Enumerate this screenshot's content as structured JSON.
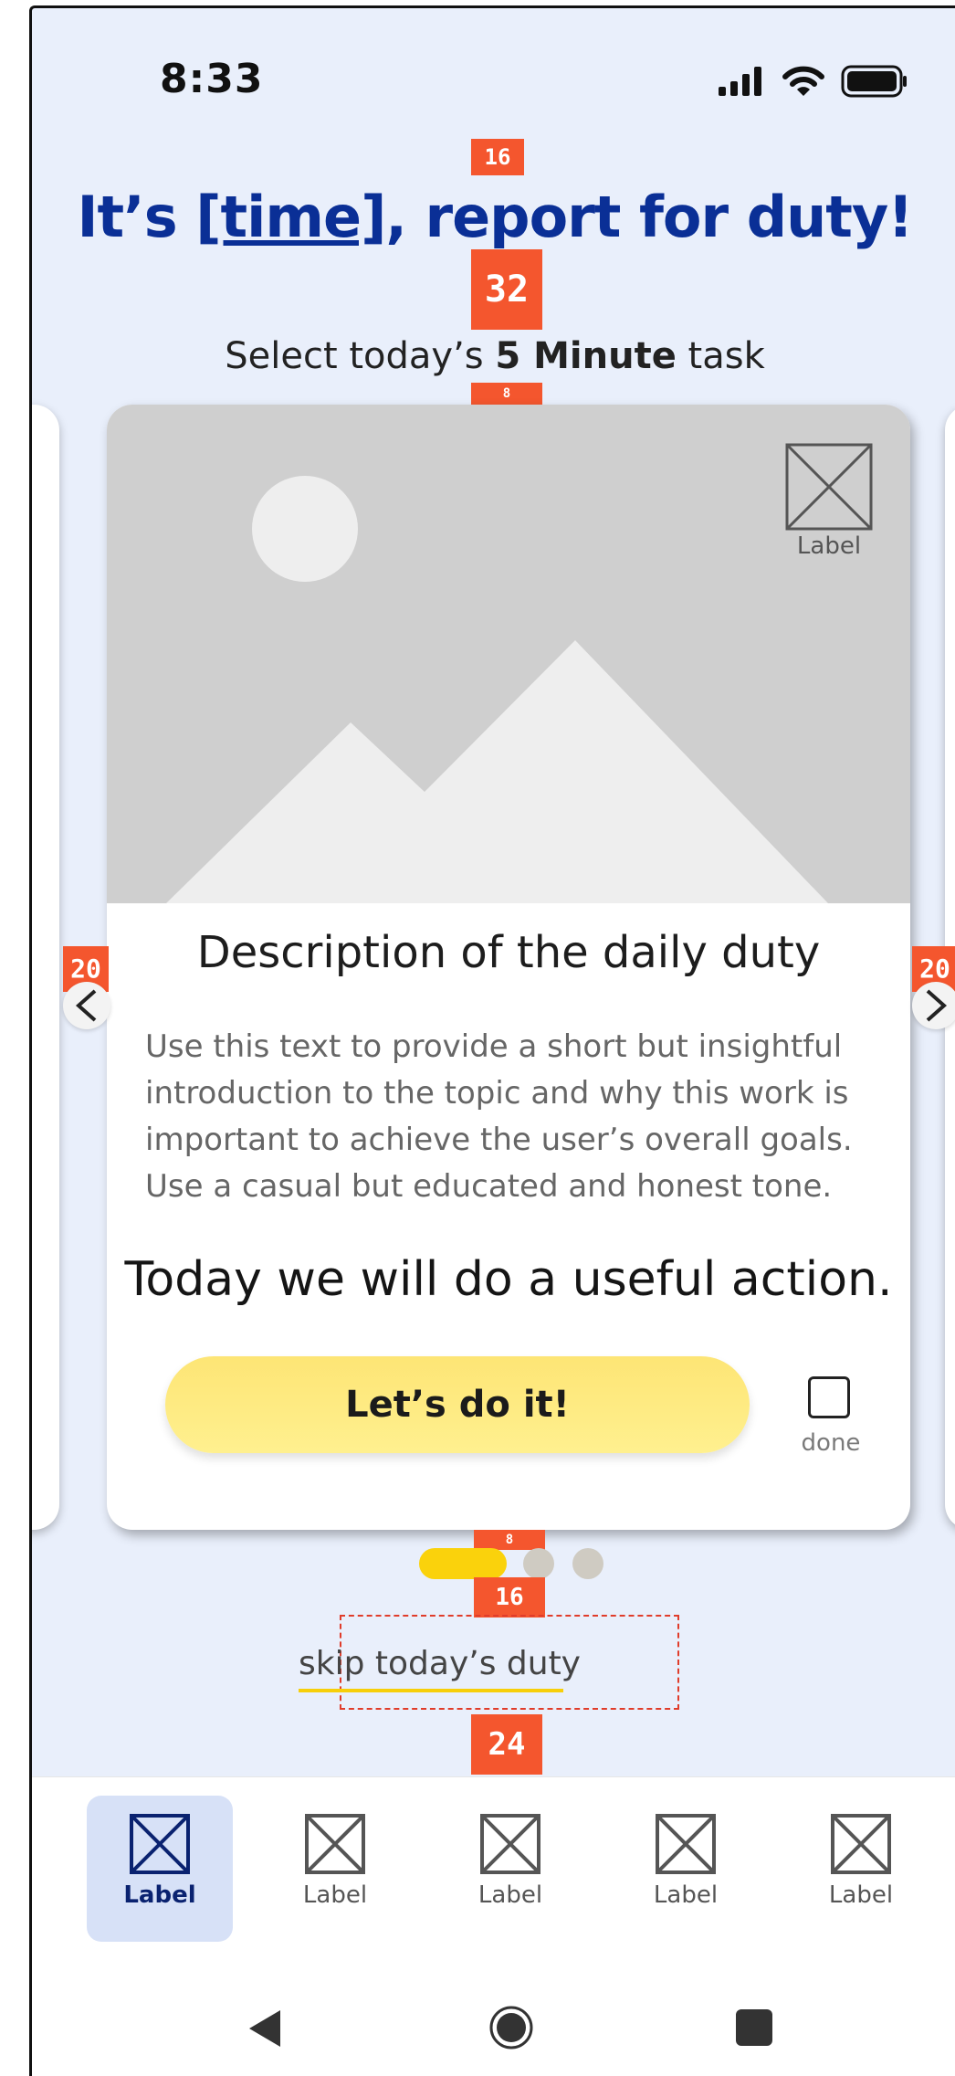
{
  "status_bar": {
    "time": "8:33"
  },
  "annotations": {
    "a1": "16",
    "a2": "32",
    "a3": "8",
    "left": "20",
    "right": "20",
    "a4": "8",
    "a5": "16",
    "a6": "24"
  },
  "header": {
    "title_prefix": "It’s ",
    "title_time": "[time]",
    "title_suffix": ", report for duty!",
    "subtitle_prefix": "Select today’s ",
    "subtitle_bold": "5 Minute",
    "subtitle_suffix": " task"
  },
  "card": {
    "image_label": "Label",
    "title": "Description of the daily duty",
    "description": "Use this text to provide a short but insightful introduction to the topic and why this work is important to achieve the user’s overall goals. Use a casual but educated and honest tone.",
    "action": "Today we will do a useful action.",
    "cta_label": "Let’s do it!",
    "done_label": "done"
  },
  "carousel": {
    "prev_icon": "chevron-left-icon",
    "next_icon": "chevron-right-icon",
    "active_index": 0,
    "count": 3
  },
  "skip_link": "skip today’s duty",
  "tabbar": {
    "tabs": [
      {
        "label": "Label",
        "active": true
      },
      {
        "label": "Label",
        "active": false
      },
      {
        "label": "Label",
        "active": false
      },
      {
        "label": "Label",
        "active": false
      },
      {
        "label": "Label",
        "active": false
      }
    ]
  },
  "colors": {
    "title": "#0a2f96",
    "accent_yellow": "#fad20c",
    "background": "#e9effb",
    "annotation": "#f4562e"
  }
}
